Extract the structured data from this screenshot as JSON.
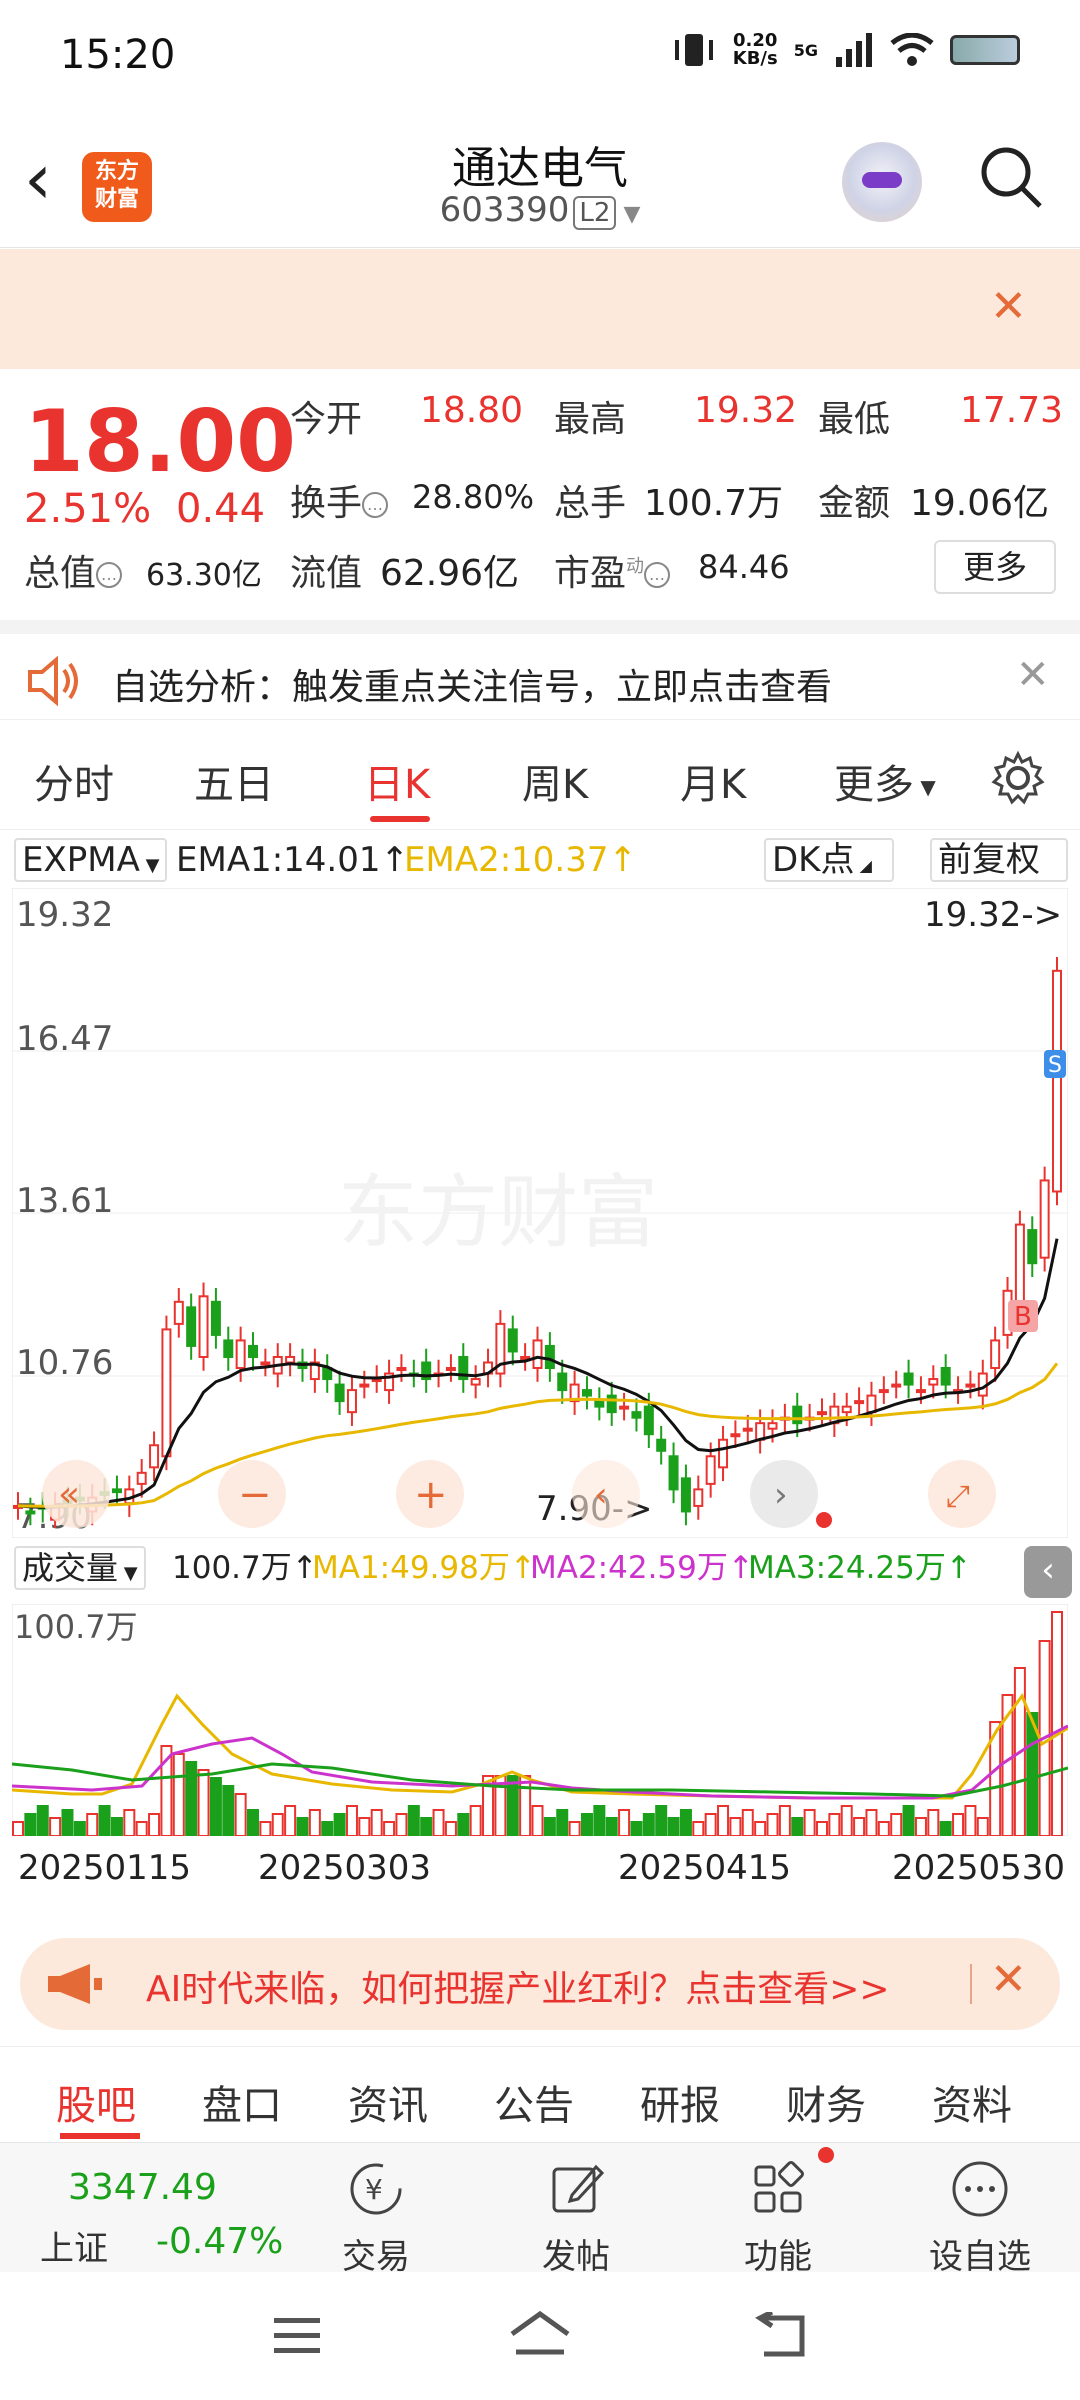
{
  "status_bar": {
    "time": "15:20",
    "net_speed": "0.20\nKB/s",
    "network": "5G"
  },
  "header": {
    "title": "通达电气",
    "code": "603390",
    "level_badge": "L2",
    "logo_text": "东方\n财富"
  },
  "quote": {
    "price": "18.00",
    "change_pct": "2.51%",
    "change": "0.44",
    "open_label": "今开",
    "open": "18.80",
    "high_label": "最高",
    "high": "19.32",
    "low_label": "最低",
    "low": "17.73",
    "turnover_label": "换手",
    "turnover": "28.80%",
    "volume_label": "总手",
    "volume": "100.7万",
    "amount_label": "金额",
    "amount": "19.06亿",
    "mcap_label": "总值",
    "mcap": "63.30亿",
    "float_label": "流值",
    "float": "62.96亿",
    "pe_label": "市盈",
    "pe_sup": "动",
    "pe": "84.46",
    "more_label": "更多"
  },
  "alert": {
    "text": "自选分析：触发重点关注信号，立即点击查看"
  },
  "tabs": [
    "分时",
    "五日",
    "日K",
    "周K",
    "月K",
    "更多"
  ],
  "active_tab": "日K",
  "chart_toolbar": {
    "indicator": "EXPMA",
    "ema1": "EMA1:14.01↑",
    "ema2": "EMA2:10.37↑",
    "dk_label": "DK点",
    "adjust_label": "前复权"
  },
  "chart_labels": {
    "y_top": "19.32",
    "y2": "16.47",
    "y3": "13.61",
    "y4": "10.76",
    "y_bottom": "7.90",
    "high_marker": "19.32->",
    "low_marker": "7.90->",
    "watermark": "东方财富",
    "buy_marker": "B",
    "sell_marker": "S"
  },
  "volume_toolbar": {
    "indicator": "成交量",
    "vol": "100.7万↑",
    "ma1": "MA1:49.98万↑",
    "ma2": "MA2:42.59万↑",
    "ma3": "MA3:24.25万↑",
    "y_max": "100.7万"
  },
  "dates": [
    "20250115",
    "20250303",
    "20250415",
    "20250530"
  ],
  "ad": {
    "text": "AI时代来临，如何把握产业红利？点击查看>>"
  },
  "sub_tabs": [
    "股吧",
    "盘口",
    "资讯",
    "公告",
    "研报",
    "财务",
    "资料"
  ],
  "active_sub_tab": "股吧",
  "bottom_bar": {
    "index_value": "3347.49",
    "index_name": "上证",
    "index_pct": "-0.47%",
    "items": [
      "交易",
      "发帖",
      "功能",
      "设自选"
    ]
  },
  "colors": {
    "up": "#e8332f",
    "down": "#1aa01a",
    "ema2": "#e8b800",
    "ma2": "#cc33cc",
    "accent": "#f05a1a"
  }
}
